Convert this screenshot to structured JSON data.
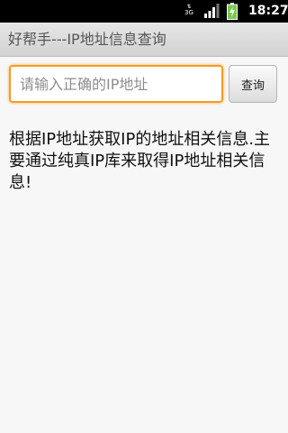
{
  "status_bar": {
    "network_type": "3G",
    "time": "18:27",
    "icons": [
      "data-3g-icon",
      "signal-strength-icon",
      "battery-charging-icon"
    ]
  },
  "app": {
    "title": "好帮手---IP地址信息查询"
  },
  "form": {
    "ip_input_placeholder": "请输入正确的IP地址",
    "ip_input_value": "",
    "query_button_label": "查询"
  },
  "description": "根据IP地址获取IP的地址相关信息.主要通过纯真IP库来取得IP地址相关信息!",
  "colors": {
    "input_focus_border": "#f39c24",
    "status_bar_bg": "#000000",
    "battery_green": "#7bc74d"
  }
}
